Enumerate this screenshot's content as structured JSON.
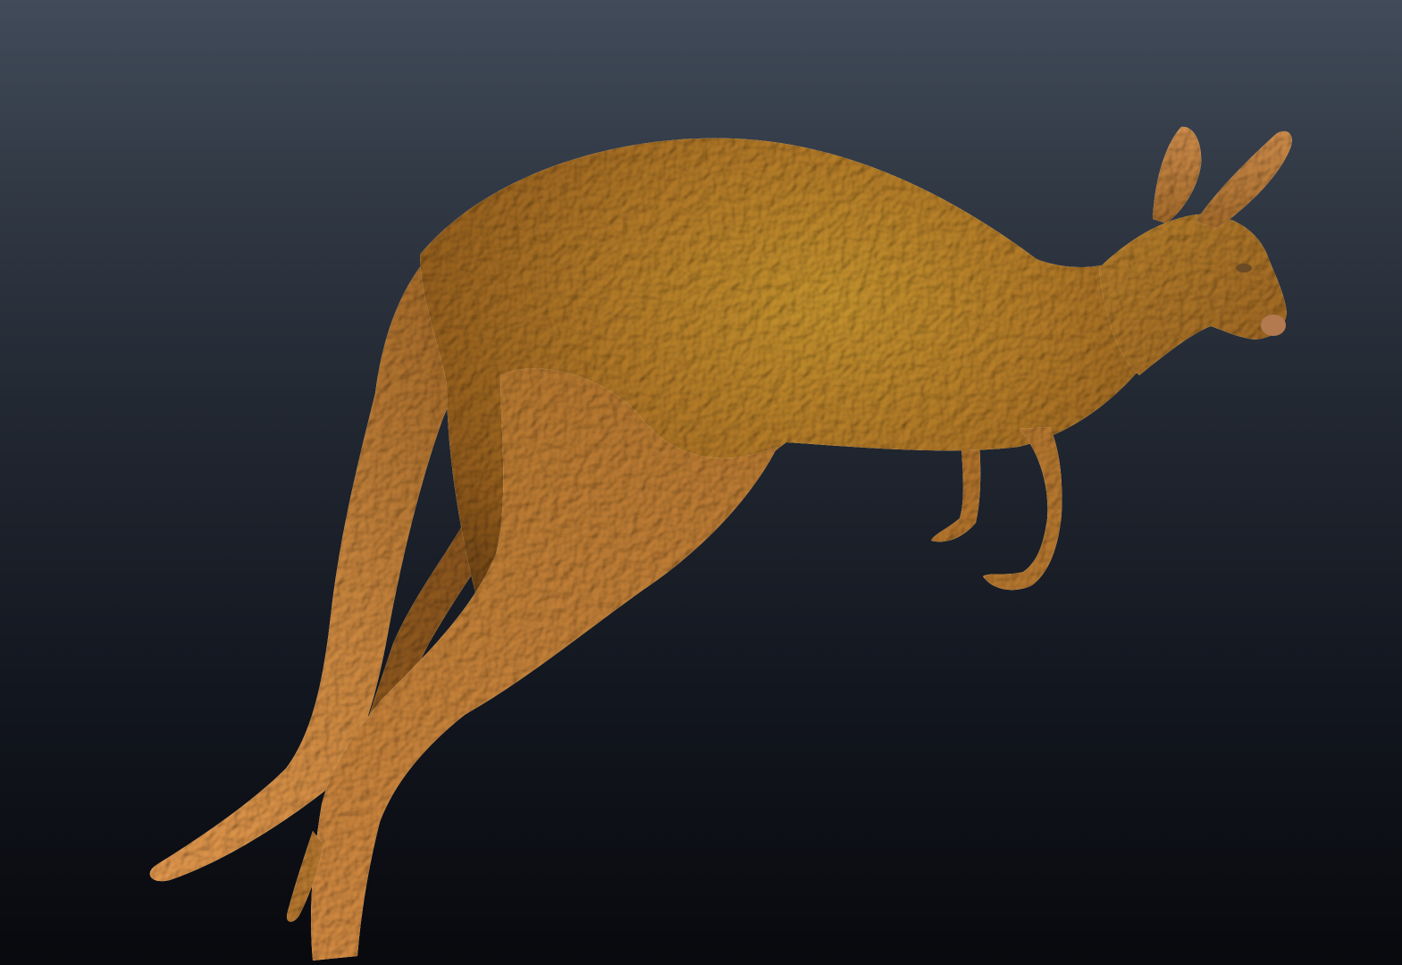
{
  "scene": {
    "subject": "kangaroo-3d-model",
    "colors": {
      "background_top": "#414b59",
      "background_bottom": "#08090d",
      "fur_base": "#b98a3e",
      "fur_highlight": "#c8a64a",
      "fur_light": "#dca06c",
      "fur_shadow": "#6e4c22"
    }
  }
}
